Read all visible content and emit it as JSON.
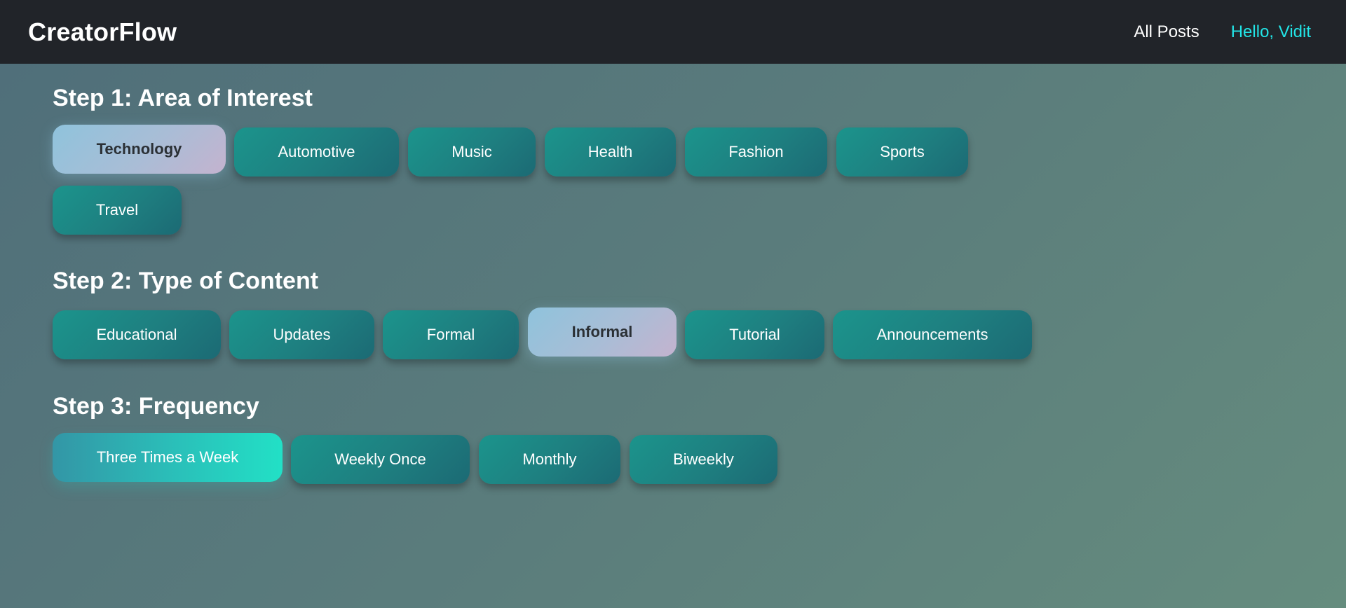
{
  "navbar": {
    "brand": "CreatorFlow",
    "links": {
      "all_posts": "All Posts",
      "greeting": "Hello, Vidit"
    }
  },
  "steps": {
    "step1": {
      "title": "Step 1: Area of Interest",
      "options": [
        "Technology",
        "Automotive",
        "Music",
        "Health",
        "Fashion",
        "Sports",
        "Travel"
      ],
      "selected": "Technology"
    },
    "step2": {
      "title": "Step 2: Type of Content",
      "options": [
        "Educational",
        "Updates",
        "Formal",
        "Informal",
        "Tutorial",
        "Announcements"
      ],
      "selected": "Informal"
    },
    "step3": {
      "title": "Step 3: Frequency",
      "options": [
        "Three Times a Week",
        "Weekly Once",
        "Monthly",
        "Biweekly"
      ],
      "selected": "Three Times a Week"
    }
  },
  "colors": {
    "navbar_bg": "#212429",
    "accent_user": "#22e4e6",
    "option_teal": "#1b948c",
    "selected_pastel_start": "#8fc3dc",
    "selected_pastel_end": "#c4b3cf",
    "selected_frequency_end": "#22e0c6"
  }
}
